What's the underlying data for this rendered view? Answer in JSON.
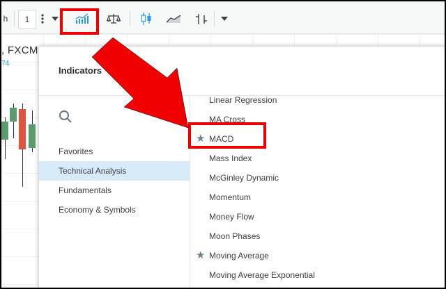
{
  "toolbar": {
    "interval_partial": "h",
    "interval_value": "1",
    "more_icon": "vertical-dots-icon",
    "dropdown_icon": "chevron-down-icon",
    "indicators_icon": "indicators-chart-icon",
    "compare_icon": "balance-scale-icon",
    "candles_icon": "candlestick-icon",
    "area_icon": "area-chart-icon",
    "bars_icon": "bar-chart-icon"
  },
  "chart": {
    "symbol_text": ", FXCM",
    "symbol_sub": "74"
  },
  "dialog": {
    "title": "Indicators",
    "search_icon": "search-icon",
    "categories": [
      {
        "label": "Favorites",
        "active": false
      },
      {
        "label": "Technical Analysis",
        "active": true
      },
      {
        "label": "Fundamentals",
        "active": false
      },
      {
        "label": "Economy & Symbols",
        "active": false
      }
    ],
    "items": [
      {
        "label": "Linear Regression",
        "favorite": false
      },
      {
        "label": "MA Cross",
        "favorite": false
      },
      {
        "label": "MACD",
        "favorite": true
      },
      {
        "label": "Mass Index",
        "favorite": false
      },
      {
        "label": "McGinley Dynamic",
        "favorite": false
      },
      {
        "label": "Momentum",
        "favorite": false
      },
      {
        "label": "Money Flow",
        "favorite": false
      },
      {
        "label": "Moon Phases",
        "favorite": false
      },
      {
        "label": "Moving Average",
        "favorite": true
      },
      {
        "label": "Moving Average Exponential",
        "favorite": false
      }
    ]
  },
  "colors": {
    "highlight": "#e00000",
    "accent": "#2196f3",
    "active_category_bg": "#d6eaf8",
    "star": "#6b7f91"
  }
}
